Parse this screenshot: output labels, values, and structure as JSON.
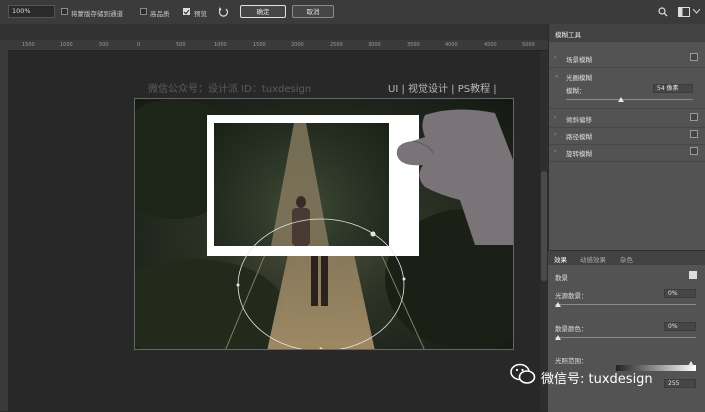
{
  "options_bar": {
    "zoom_value": "100%",
    "save_mask_label": "将蒙版存储到通道",
    "high_quality_label": "高品质",
    "preview_label": "预览",
    "preview_checked": true,
    "ok_label": "确定",
    "cancel_label": "取消"
  },
  "ruler": {
    "ticks": [
      "1500",
      "1000",
      "500",
      "0",
      "500",
      "1000",
      "1500",
      "2000",
      "2500",
      "3000",
      "3500",
      "4000",
      "4500",
      "5000"
    ]
  },
  "canvas": {
    "watermark_left": "微信公众号：设计派  ID：tuxdesign",
    "watermark_right": "UI | 视觉设计 | PS教程 |"
  },
  "blur_panel": {
    "title": "模糊工具",
    "items": [
      {
        "label": "场景模糊",
        "checked": false,
        "expanded": false
      },
      {
        "label": "光圈模糊",
        "checked": true,
        "expanded": true
      },
      {
        "label": "倾斜偏移",
        "checked": false,
        "expanded": false
      },
      {
        "label": "路径模糊",
        "checked": false,
        "expanded": false
      },
      {
        "label": "旋转模糊",
        "checked": false,
        "expanded": false
      }
    ],
    "iris": {
      "label": "模糊：",
      "value": "54 像素"
    }
  },
  "effects_panel": {
    "tabs": [
      "效果",
      "动感效果",
      "杂色"
    ],
    "bokeh_label": "散景",
    "bokeh_checked": true,
    "light_bokeh_label": "光源散景：",
    "light_bokeh_value": "0%",
    "bokeh_color_label": "散景颜色：",
    "bokeh_color_value": "0%",
    "light_range_label": "光照范围：",
    "light_range_value": "255"
  },
  "watermark_footer": {
    "text": "微信号: tuxdesign"
  }
}
